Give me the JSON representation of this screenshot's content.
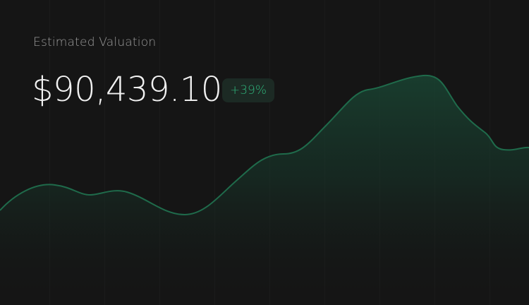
{
  "valuation": {
    "label": "Estimated Valuation",
    "amount": "$90,439.10",
    "change_badge": "+39%"
  },
  "colors": {
    "background": "#151515",
    "accent": "#2fb27a",
    "badge_background": "#1c2a24",
    "line": "#1f6b4b"
  }
}
